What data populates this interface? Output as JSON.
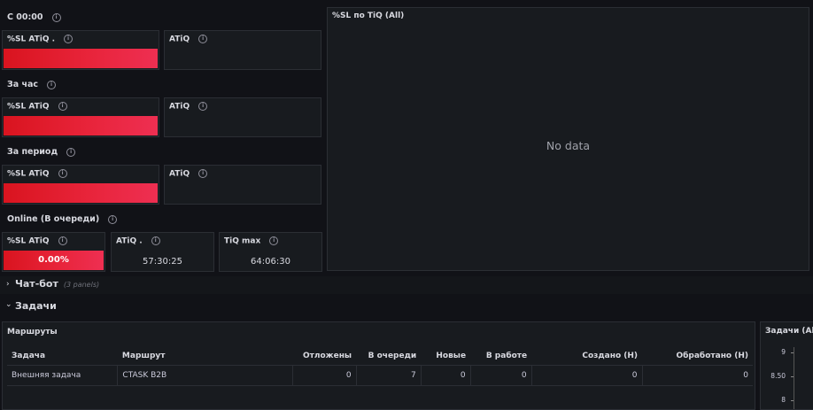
{
  "rows": {
    "since_midnight": "С 00:00",
    "per_hour": "За час",
    "per_period": "За период",
    "online": "Online (В очереди)"
  },
  "stats": {
    "sl_title_1": "%SL ATiQ .",
    "atiq_title_1": "ATiQ",
    "sl_title_2": "%SL ATiQ",
    "atiq_title_2": "ATiQ",
    "sl_title_3": "%SL ATiQ",
    "atiq_title_3": "ATiQ",
    "sl_title_4": "%SL ATiQ",
    "sl_value_4": "0.00%",
    "atiq_title_4": "ATiQ .",
    "atiq_value_4": "57:30:25",
    "tiq_max_title": "TiQ max",
    "tiq_max_value": "64:06:30"
  },
  "chart_panel": {
    "title": "%SL по TiQ (All)",
    "empty_text": "No data"
  },
  "sections": {
    "chatbot": "Чат-бот",
    "chatbot_count": "(3 panels)",
    "tasks": "Задачи"
  },
  "routes_table": {
    "title": "Маршруты",
    "columns": [
      "Задача",
      "Маршрут",
      "Отложены",
      "В очереди",
      "Новые",
      "В работе",
      "Создано (Н)",
      "Обработано (Н)"
    ],
    "rows": [
      [
        "Внешняя задача",
        "CTASK B2B",
        "0",
        "7",
        "0",
        "0",
        "0",
        "0"
      ]
    ]
  },
  "tasks_panel": {
    "title": "Задачи (All)",
    "y_ticks": [
      "9",
      "8.50",
      "8"
    ]
  },
  "colors": {
    "background": "#111217",
    "panel": "#181b1f",
    "border": "#2b2e34",
    "bar_red": "#e02f44"
  },
  "icons": {
    "info": "info-circle-icon",
    "chevron_right": "chevron-right-icon",
    "chevron_down": "chevron-down-icon"
  }
}
